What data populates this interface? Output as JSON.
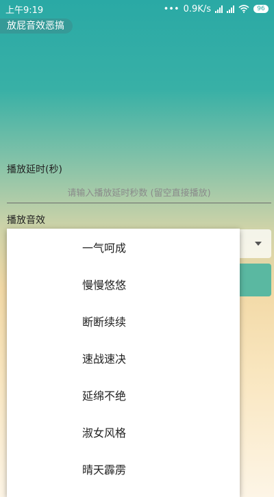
{
  "status_bar": {
    "time": "上午9:19",
    "network_speed": "0.9K/s",
    "battery": "96"
  },
  "app": {
    "title": "放屁音效恶搞"
  },
  "delay": {
    "label": "播放延时(秒)",
    "placeholder": "请输入播放延时秒数 (留空直接播放)"
  },
  "sound": {
    "label": "播放音效",
    "options": [
      "一气呵成",
      "慢慢悠悠",
      "断断续续",
      "速战速决",
      "延绵不绝",
      "淑女风格",
      "晴天霹雳"
    ]
  }
}
